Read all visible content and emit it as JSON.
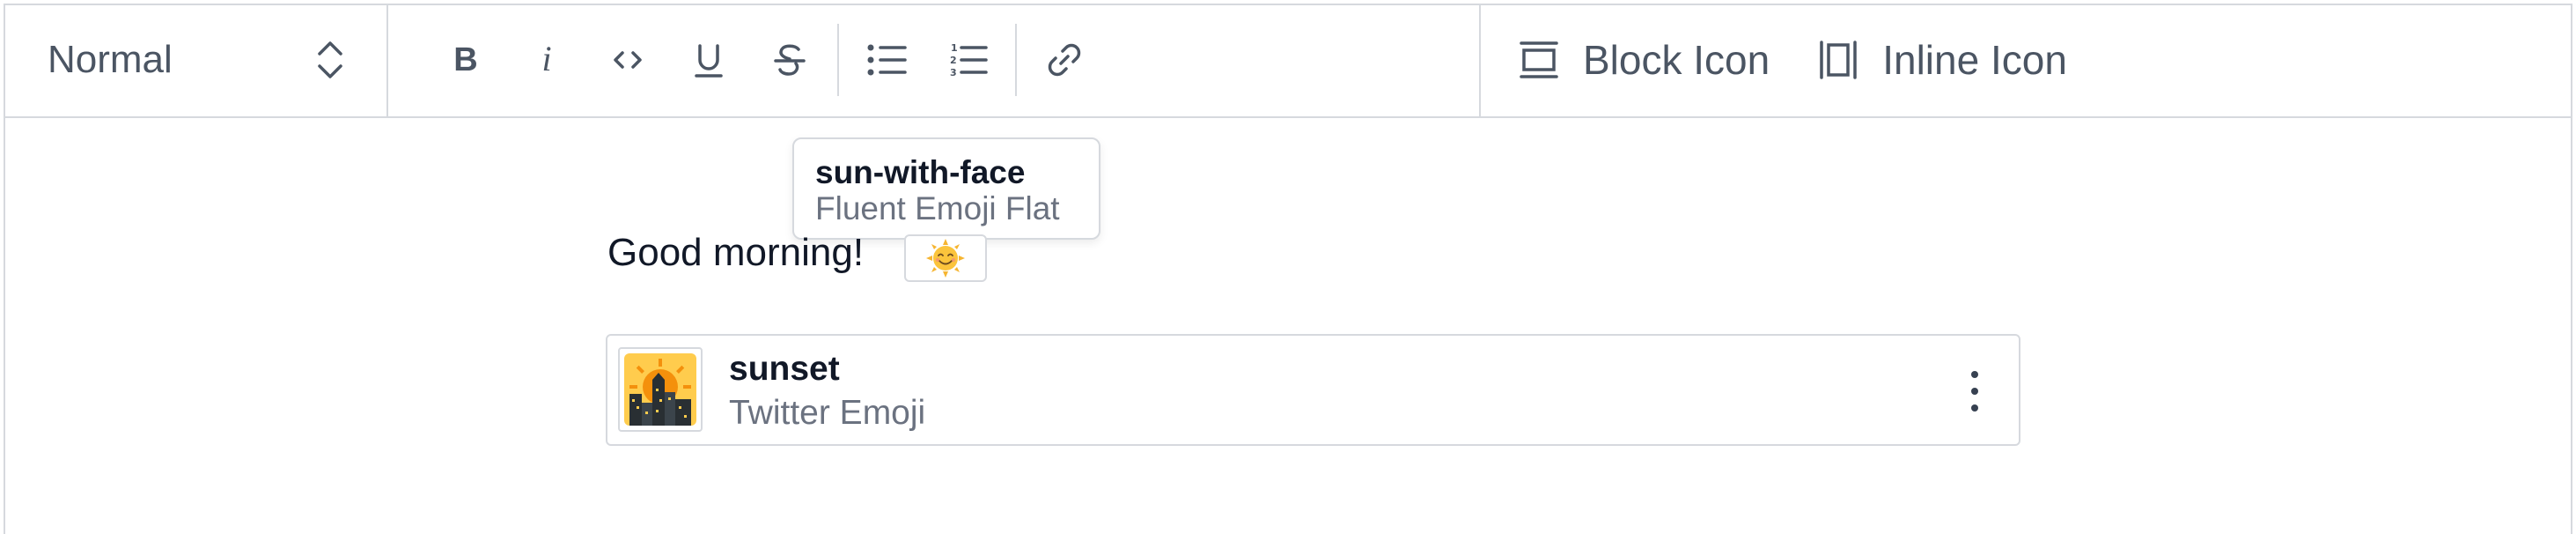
{
  "toolbar": {
    "block_type": {
      "label": "Normal",
      "icon": "chevron-up-down-icon"
    },
    "format_buttons": [
      {
        "name": "bold",
        "icon": "bold-icon"
      },
      {
        "name": "italic",
        "icon": "italic-icon"
      },
      {
        "name": "code",
        "icon": "code-icon"
      },
      {
        "name": "underline",
        "icon": "underline-icon"
      },
      {
        "name": "strikethrough",
        "icon": "strikethrough-icon"
      },
      {
        "name": "bulleted-list",
        "icon": "bulleted-list-icon"
      },
      {
        "name": "numbered-list",
        "icon": "numbered-list-icon"
      },
      {
        "name": "link",
        "icon": "link-icon"
      }
    ],
    "actions": {
      "block_icon_label": "Block Icon",
      "inline_icon_label": "Inline Icon"
    }
  },
  "editor": {
    "paragraph_text": "Good morning!",
    "inline_emoji": {
      "icon": "sun-with-face-icon"
    },
    "tooltip": {
      "title": "sun-with-face",
      "subtitle": "Fluent Emoji Flat"
    },
    "block_icon": {
      "name": "sunset",
      "source": "Twitter Emoji",
      "icon": "sunset-icon"
    }
  },
  "colors": {
    "border": "#d6d9de",
    "toolbar_icon": "#4b5563",
    "text": "#111827",
    "muted_text": "#6b7280"
  }
}
